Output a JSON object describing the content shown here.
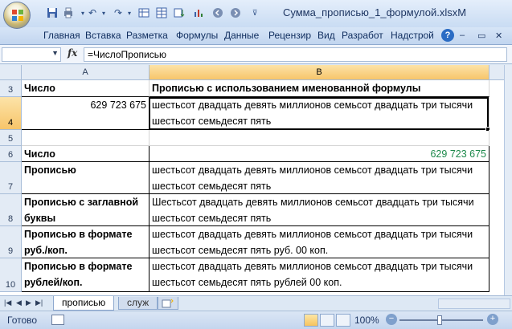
{
  "window": {
    "title": "Сумма_прописью_1_формулой.xlsx",
    "title_suffix": "M"
  },
  "ribbon": {
    "tabs": [
      "Главная",
      "Вставка",
      "Разметка",
      "Формулы",
      "Данные",
      "Рецензир",
      "Вид",
      "Разработ",
      "Надстрой"
    ]
  },
  "formula_bar": {
    "name_box": "",
    "fx_label": "fx",
    "formula": "=ЧислоПрописью"
  },
  "grid": {
    "columns": [
      "A",
      "B"
    ],
    "selected_column": "B",
    "rows": [
      {
        "num": "3",
        "a": "Число",
        "b": "Прописью с использованием именованной формулы"
      },
      {
        "num": "4",
        "a": "629 723 675",
        "b": "шестьсот двадцать девять миллионов семьсот двадцать три тысячи шестьсот семьдесят пять"
      },
      {
        "num": "5",
        "a": "",
        "b": ""
      },
      {
        "num": "6",
        "a": "Число",
        "b": "629 723 675"
      },
      {
        "num": "7",
        "a": "Прописью",
        "b": "шестьсот двадцать девять миллионов семьсот двадцать три тысячи шестьсот семьдесят пять"
      },
      {
        "num": "8",
        "a": "Прописью с заглавной буквы",
        "b": "Шестьсот двадцать девять миллионов семьсот двадцать три тысячи шестьсот семьдесят пять"
      },
      {
        "num": "9",
        "a": "Прописью в формате руб./коп.",
        "b": "шестьсот двадцать девять миллионов семьсот двадцать три тысячи шестьсот семьдесят пять руб. 00 коп."
      },
      {
        "num": "10",
        "a": "Прописью в формате рублей/коп.",
        "b": "шестьсот двадцать девять миллионов семьсот двадцать три тысячи шестьсот семьдесят пять рублей 00 коп."
      }
    ]
  },
  "sheet_tabs": {
    "active": "прописью",
    "other": "служ"
  },
  "status_bar": {
    "status": "Готово",
    "zoom": "100%"
  },
  "colors": {
    "selected_header": "#f7c56a",
    "number_green": "#1e8a4c",
    "ribbon_text": "#0f2d5e"
  }
}
